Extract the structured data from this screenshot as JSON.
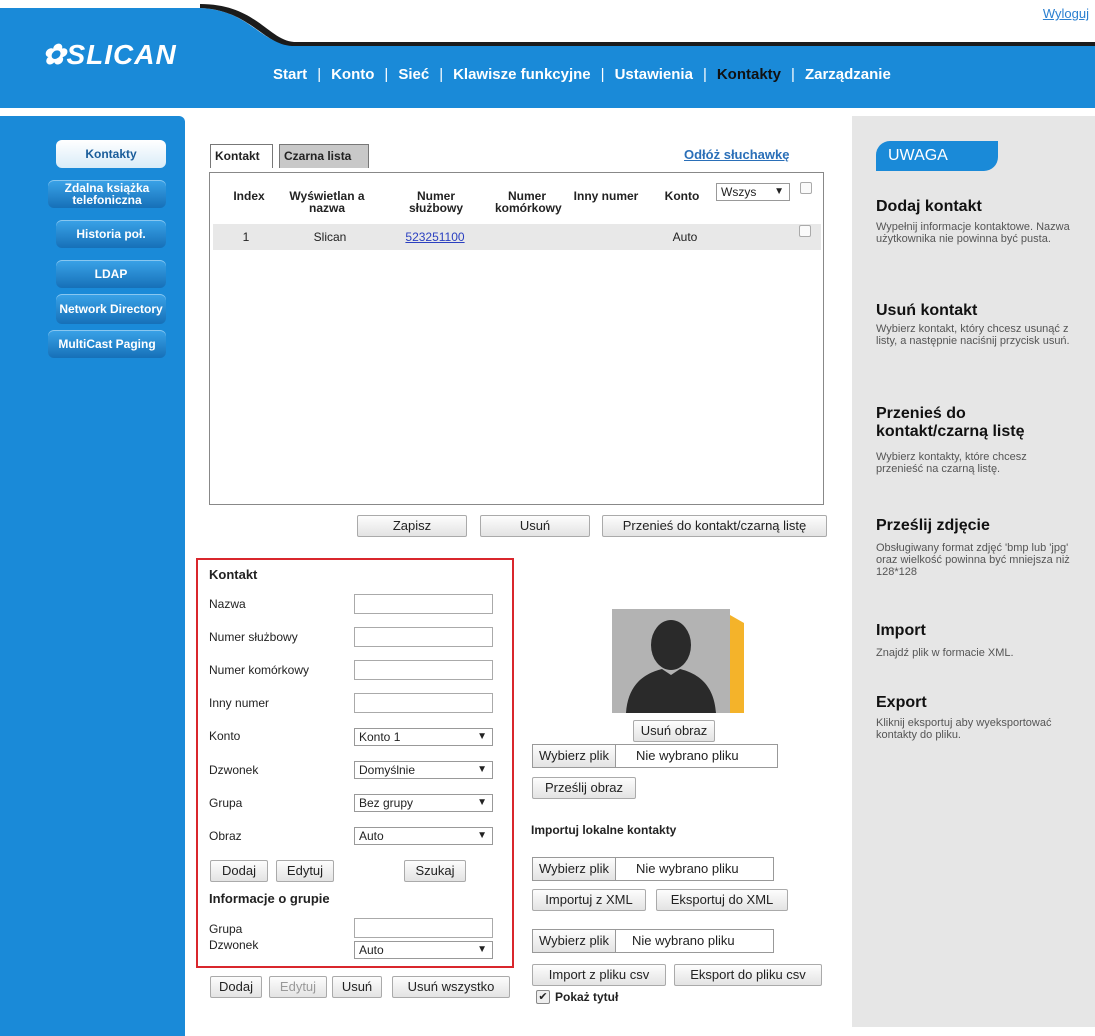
{
  "header": {
    "logo": "SLICAN",
    "logout": "Wyloguj",
    "nav": [
      "Start",
      "Konto",
      "Sieć",
      "Klawisze funkcyjne",
      "Ustawienia",
      "Kontakty",
      "Zarządzanie"
    ],
    "active_nav": "Kontakty"
  },
  "sidebar": {
    "items": [
      "Kontakty",
      "Zdalna książka telefoniczna",
      "Historia poł.",
      "LDAP",
      "Network Directory",
      "MultiCast Paging"
    ]
  },
  "contacts": {
    "tabs": [
      "Kontakt",
      "Czarna lista"
    ],
    "hangup_link": "Odłóż słuchawkę",
    "columns": [
      "Index",
      "Wyświetlan a nazwa",
      "Numer służbowy",
      "Numer komórkowy",
      "Inny numer",
      "Konto"
    ],
    "account_filter": "Wszys",
    "rows": [
      {
        "index": "1",
        "name": "Slican",
        "office": "523251100",
        "mobile": "",
        "other": "",
        "account": "Auto"
      }
    ],
    "buttons": {
      "save": "Zapisz",
      "delete": "Usuń",
      "move": "Przenieś do kontakt/czarną listę"
    }
  },
  "contact_form": {
    "title": "Kontakt",
    "fields": {
      "name": {
        "label": "Nazwa",
        "value": ""
      },
      "office": {
        "label": "Numer służbowy",
        "value": ""
      },
      "mobile": {
        "label": "Numer komórkowy",
        "value": ""
      },
      "other": {
        "label": "Inny numer",
        "value": ""
      },
      "account": {
        "label": "Konto",
        "value": "Konto 1"
      },
      "ringtone": {
        "label": "Dzwonek",
        "value": "Domyślnie"
      },
      "group": {
        "label": "Grupa",
        "value": "Bez grupy"
      },
      "image": {
        "label": "Obraz",
        "value": "Auto"
      }
    },
    "buttons": {
      "add": "Dodaj",
      "edit": "Edytuj",
      "search": "Szukaj"
    },
    "group_info": {
      "title": "Informacje o grupie",
      "group_label": "Grupa",
      "ringtone_label": "Dzwonek",
      "ringtone_value": "Auto"
    },
    "bottom_buttons": {
      "add": "Dodaj",
      "edit": "Edytuj",
      "delete": "Usuń",
      "delete_all": "Usuń wszystko"
    }
  },
  "image_panel": {
    "remove_image": "Usuń obraz",
    "choose_file": "Wybierz plik",
    "no_file": "Nie wybrano pliku",
    "upload_image": "Prześlij obraz",
    "import_title": "Importuj lokalne kontakty",
    "import_xml": "Importuj z XML",
    "export_xml": "Eksportuj do XML",
    "import_csv": "Import z pliku csv",
    "export_csv": "Eksport do pliku csv",
    "show_title": "Pokaż tytuł",
    "show_title_checked": true
  },
  "help": {
    "badge": "UWAGA",
    "sections": [
      {
        "title": "Dodaj kontakt",
        "text": "Wypełnij informacje kontaktowe. Nazwa użytkownika nie powinna być pusta."
      },
      {
        "title": "Usuń kontakt",
        "text": "Wybierz kontakt, który chcesz usunąć z listy, a następnie naciśnij przycisk usuń."
      },
      {
        "title": "Przenieś do kontakt/czarną listę",
        "text": "Wybierz kontakty, które chcesz przenieść na czarną listę."
      },
      {
        "title": "Prześlij zdjęcie",
        "text": "Obsługiwany format zdjęć 'bmp lub 'jpg' oraz wielkość powinna być mniejsza niż 128*128"
      },
      {
        "title": "Import",
        "text": "Znajdź plik w formacie XML."
      },
      {
        "title": "Export",
        "text": "Kliknij eksportuj aby wyeksportować kontakty do pliku."
      }
    ]
  },
  "colors": {
    "primary": "#1a8ad8",
    "dark": "#1b1b1b",
    "highlight_border": "#d9262c",
    "avatar_accent": "#f4b32a"
  }
}
